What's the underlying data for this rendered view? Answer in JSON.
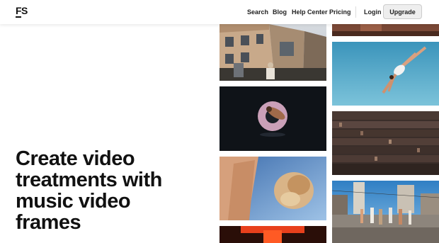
{
  "nav": {
    "logo": "FS",
    "links": [
      "Search",
      "Blog",
      "Help Center",
      "Pricing"
    ],
    "login": "Login",
    "upgrade": "Upgrade"
  },
  "hero": {
    "headline_lines": [
      "Create video",
      "treatments with",
      "music video",
      "frames"
    ]
  },
  "gallery": {
    "frames": [
      {
        "name": "street-building-frame"
      },
      {
        "name": "floating-ring-frame"
      },
      {
        "name": "hand-closeup-frame"
      },
      {
        "name": "red-light-frame"
      },
      {
        "name": "top-strip-frame"
      },
      {
        "name": "jumping-person-frame"
      },
      {
        "name": "crowd-frame"
      },
      {
        "name": "street-dancers-frame"
      }
    ]
  }
}
